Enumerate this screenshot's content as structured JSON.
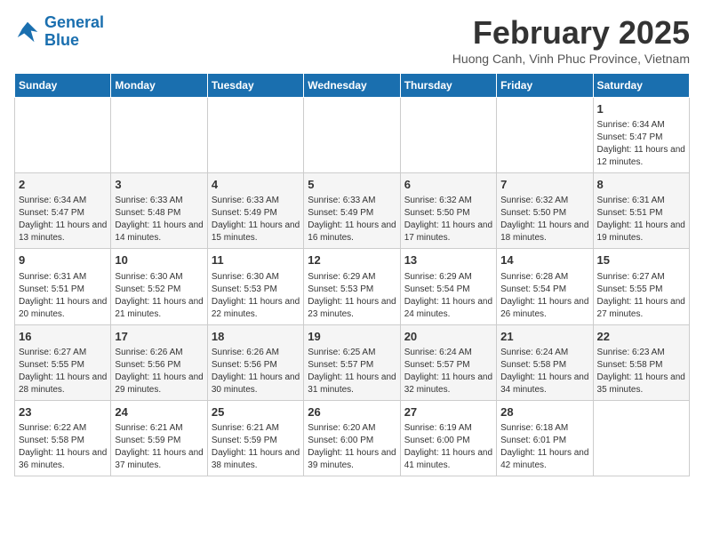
{
  "logo": {
    "line1": "General",
    "line2": "Blue"
  },
  "title": "February 2025",
  "location": "Huong Canh, Vinh Phuc Province, Vietnam",
  "weekdays": [
    "Sunday",
    "Monday",
    "Tuesday",
    "Wednesday",
    "Thursday",
    "Friday",
    "Saturday"
  ],
  "weeks": [
    [
      {
        "day": "",
        "info": ""
      },
      {
        "day": "",
        "info": ""
      },
      {
        "day": "",
        "info": ""
      },
      {
        "day": "",
        "info": ""
      },
      {
        "day": "",
        "info": ""
      },
      {
        "day": "",
        "info": ""
      },
      {
        "day": "1",
        "info": "Sunrise: 6:34 AM\nSunset: 5:47 PM\nDaylight: 11 hours and 12 minutes."
      }
    ],
    [
      {
        "day": "2",
        "info": "Sunrise: 6:34 AM\nSunset: 5:47 PM\nDaylight: 11 hours and 13 minutes."
      },
      {
        "day": "3",
        "info": "Sunrise: 6:33 AM\nSunset: 5:48 PM\nDaylight: 11 hours and 14 minutes."
      },
      {
        "day": "4",
        "info": "Sunrise: 6:33 AM\nSunset: 5:49 PM\nDaylight: 11 hours and 15 minutes."
      },
      {
        "day": "5",
        "info": "Sunrise: 6:33 AM\nSunset: 5:49 PM\nDaylight: 11 hours and 16 minutes."
      },
      {
        "day": "6",
        "info": "Sunrise: 6:32 AM\nSunset: 5:50 PM\nDaylight: 11 hours and 17 minutes."
      },
      {
        "day": "7",
        "info": "Sunrise: 6:32 AM\nSunset: 5:50 PM\nDaylight: 11 hours and 18 minutes."
      },
      {
        "day": "8",
        "info": "Sunrise: 6:31 AM\nSunset: 5:51 PM\nDaylight: 11 hours and 19 minutes."
      }
    ],
    [
      {
        "day": "9",
        "info": "Sunrise: 6:31 AM\nSunset: 5:51 PM\nDaylight: 11 hours and 20 minutes."
      },
      {
        "day": "10",
        "info": "Sunrise: 6:30 AM\nSunset: 5:52 PM\nDaylight: 11 hours and 21 minutes."
      },
      {
        "day": "11",
        "info": "Sunrise: 6:30 AM\nSunset: 5:53 PM\nDaylight: 11 hours and 22 minutes."
      },
      {
        "day": "12",
        "info": "Sunrise: 6:29 AM\nSunset: 5:53 PM\nDaylight: 11 hours and 23 minutes."
      },
      {
        "day": "13",
        "info": "Sunrise: 6:29 AM\nSunset: 5:54 PM\nDaylight: 11 hours and 24 minutes."
      },
      {
        "day": "14",
        "info": "Sunrise: 6:28 AM\nSunset: 5:54 PM\nDaylight: 11 hours and 26 minutes."
      },
      {
        "day": "15",
        "info": "Sunrise: 6:27 AM\nSunset: 5:55 PM\nDaylight: 11 hours and 27 minutes."
      }
    ],
    [
      {
        "day": "16",
        "info": "Sunrise: 6:27 AM\nSunset: 5:55 PM\nDaylight: 11 hours and 28 minutes."
      },
      {
        "day": "17",
        "info": "Sunrise: 6:26 AM\nSunset: 5:56 PM\nDaylight: 11 hours and 29 minutes."
      },
      {
        "day": "18",
        "info": "Sunrise: 6:26 AM\nSunset: 5:56 PM\nDaylight: 11 hours and 30 minutes."
      },
      {
        "day": "19",
        "info": "Sunrise: 6:25 AM\nSunset: 5:57 PM\nDaylight: 11 hours and 31 minutes."
      },
      {
        "day": "20",
        "info": "Sunrise: 6:24 AM\nSunset: 5:57 PM\nDaylight: 11 hours and 32 minutes."
      },
      {
        "day": "21",
        "info": "Sunrise: 6:24 AM\nSunset: 5:58 PM\nDaylight: 11 hours and 34 minutes."
      },
      {
        "day": "22",
        "info": "Sunrise: 6:23 AM\nSunset: 5:58 PM\nDaylight: 11 hours and 35 minutes."
      }
    ],
    [
      {
        "day": "23",
        "info": "Sunrise: 6:22 AM\nSunset: 5:58 PM\nDaylight: 11 hours and 36 minutes."
      },
      {
        "day": "24",
        "info": "Sunrise: 6:21 AM\nSunset: 5:59 PM\nDaylight: 11 hours and 37 minutes."
      },
      {
        "day": "25",
        "info": "Sunrise: 6:21 AM\nSunset: 5:59 PM\nDaylight: 11 hours and 38 minutes."
      },
      {
        "day": "26",
        "info": "Sunrise: 6:20 AM\nSunset: 6:00 PM\nDaylight: 11 hours and 39 minutes."
      },
      {
        "day": "27",
        "info": "Sunrise: 6:19 AM\nSunset: 6:00 PM\nDaylight: 11 hours and 41 minutes."
      },
      {
        "day": "28",
        "info": "Sunrise: 6:18 AM\nSunset: 6:01 PM\nDaylight: 11 hours and 42 minutes."
      },
      {
        "day": "",
        "info": ""
      }
    ]
  ]
}
